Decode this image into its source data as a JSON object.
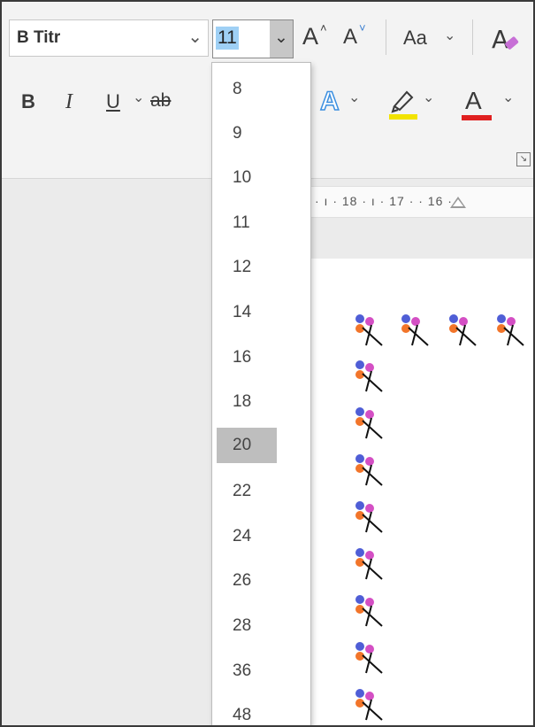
{
  "ribbon": {
    "font_name": "B Titr",
    "font_size": "11",
    "bold_label": "B",
    "italic_label": "I",
    "underline_label": "U",
    "strikethrough_label": "ab",
    "grow_font_label": "A",
    "shrink_font_label": "A",
    "change_case_label": "Aa",
    "text_effects_label": "A",
    "font_color_label": "A",
    "highlight_color": "#f2e300",
    "font_color": "#e02020",
    "text_effects_color": "#3b8fe0"
  },
  "ruler": {
    "text": "· ı · 18 · ı · 17 ·   · 16 · ı"
  },
  "size_dropdown": {
    "options": [
      "8",
      "9",
      "10",
      "11",
      "12",
      "14",
      "16",
      "18",
      "20",
      "22",
      "24",
      "26",
      "28",
      "36",
      "48"
    ],
    "highlighted": "20"
  }
}
